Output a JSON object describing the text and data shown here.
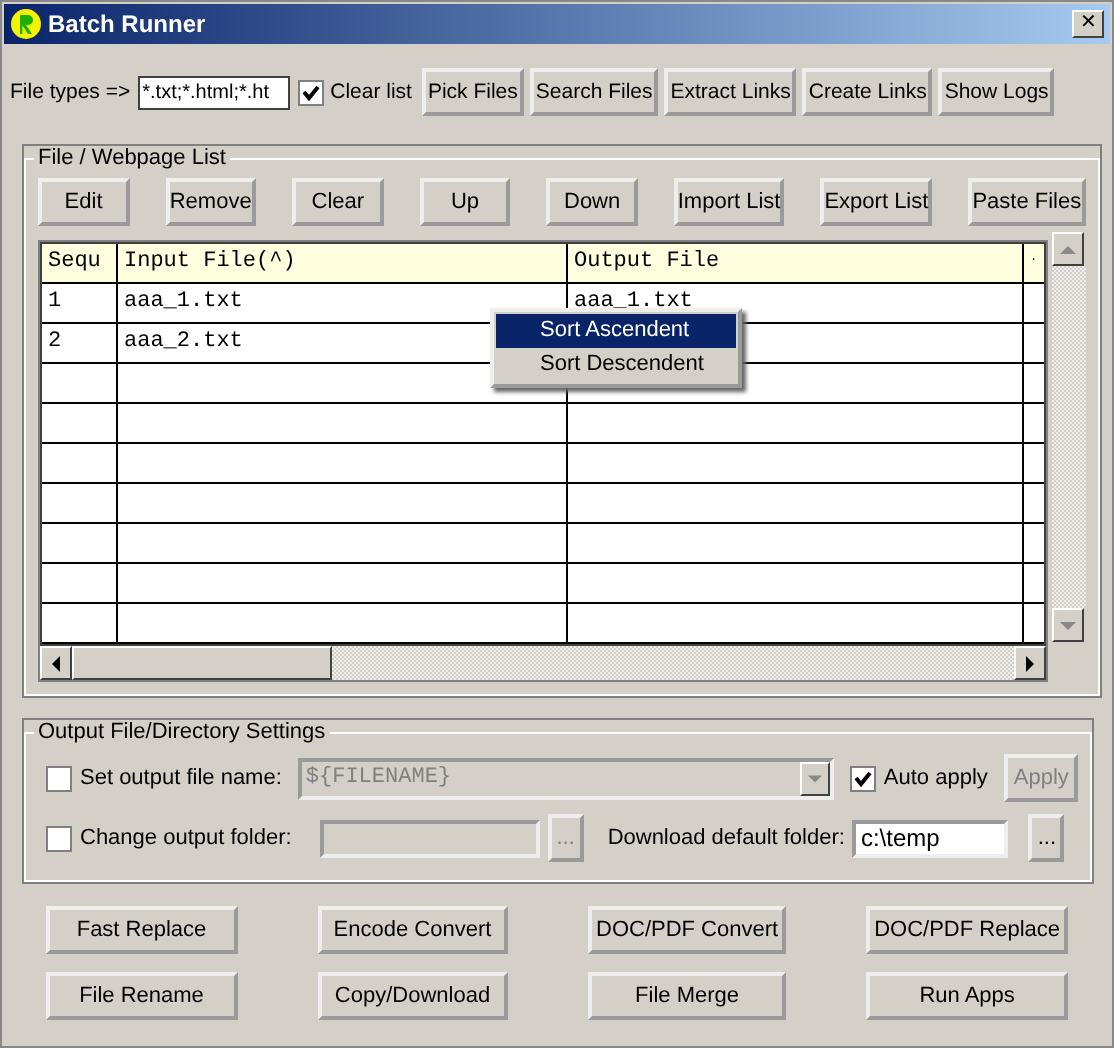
{
  "window": {
    "title": "Batch Runner",
    "close": "✕"
  },
  "toolbar": {
    "file_types_label": "File types =>",
    "file_types_value": "*.txt;*.html;*.ht",
    "clear_list": {
      "label": "Clear list",
      "checked": true
    },
    "buttons": [
      "Pick Files",
      "Search Files",
      "Extract Links",
      "Create Links",
      "Show Logs"
    ]
  },
  "file_list": {
    "title": "File / Webpage List",
    "buttons": [
      "Edit",
      "Remove",
      "Clear",
      "Up",
      "Down",
      "Import List",
      "Export List",
      "Paste Files"
    ],
    "table": {
      "columns": [
        "Sequ",
        "Input File(^)",
        "Output File",
        "."
      ],
      "rows": [
        {
          "cells": [
            "1",
            "aaa_1.txt",
            "aaa_1.txt"
          ]
        },
        {
          "cells": [
            "2",
            "aaa_2.txt"
          ]
        }
      ]
    },
    "context_menu": [
      {
        "label": "Sort Ascendent",
        "selected": true
      },
      {
        "label": "Sort Descendent",
        "selected": false
      }
    ]
  },
  "output_settings": {
    "title": "Output File/Directory Settings",
    "set_output_name": {
      "label": "Set output file name:",
      "checked": false,
      "value": "${FILENAME}",
      "disabled": true
    },
    "auto_apply": {
      "label": "Auto apply",
      "checked": true
    },
    "apply": {
      "label": "Apply",
      "disabled": true
    },
    "change_folder": {
      "label": "Change output folder:",
      "checked": false,
      "disabled": true,
      "browse": "..."
    },
    "download_folder": {
      "label": "Download default folder:",
      "value": "c:\\temp",
      "browse": "..."
    }
  },
  "bottom_buttons": [
    "Fast Replace",
    "Encode Convert",
    "DOC/PDF Convert",
    "DOC/PDF Replace",
    "File Rename",
    "Copy/Download",
    "File Merge",
    "Run Apps"
  ]
}
